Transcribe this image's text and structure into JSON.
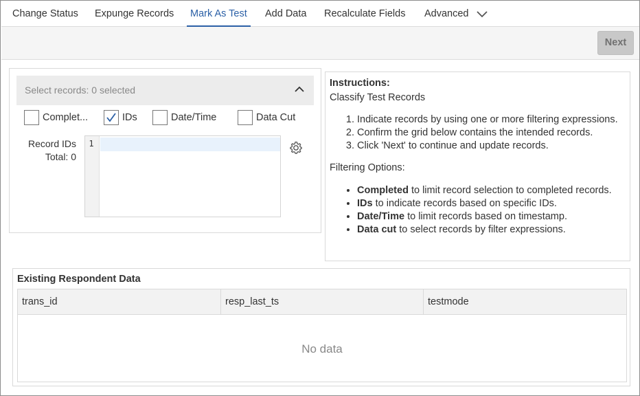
{
  "tabs": [
    {
      "label": "Change Status"
    },
    {
      "label": "Expunge Records"
    },
    {
      "label": "Mark As Test"
    },
    {
      "label": "Add Data"
    },
    {
      "label": "Recalculate Fields"
    },
    {
      "label": "Advanced"
    }
  ],
  "active_tab": "Mark As Test",
  "toolbar": {
    "next_label": "Next"
  },
  "select": {
    "header": "Select records: 0 selected"
  },
  "filters": [
    {
      "label": "Complet...",
      "checked": false
    },
    {
      "label": "IDs",
      "checked": true
    },
    {
      "label": "Date/Time",
      "checked": false
    },
    {
      "label": "Data Cut",
      "checked": false
    }
  ],
  "record_ids": {
    "label": "Record IDs",
    "total": "Total: 0",
    "line_number": "1"
  },
  "instructions": {
    "heading": "Instructions:",
    "subtitle": "Classify Test Records",
    "steps": [
      "Indicate records by using one or more filtering expressions.",
      "Confirm the grid below contains the intended records.",
      "Click 'Next' to continue and update records."
    ],
    "options_heading": "Filtering Options:",
    "options": [
      {
        "term": "Completed",
        "desc": " to limit record selection to completed records."
      },
      {
        "term": "IDs",
        "desc": " to indicate records based on specific IDs."
      },
      {
        "term": "Date/Time",
        "desc": " to limit records based on timestamp."
      },
      {
        "term": "Data cut",
        "desc": " to select records by filter expressions."
      }
    ]
  },
  "existing": {
    "title": "Existing Respondent Data",
    "columns": [
      "trans_id",
      "resp_last_ts",
      "testmode"
    ],
    "empty_text": "No data"
  },
  "colors": {
    "accent": "#2a5fa6",
    "disabled_button": "#c8c8c8"
  },
  "icons": {
    "advanced": "chevron-down-icon",
    "collapse": "chevron-up-icon",
    "settings": "gear-icon",
    "check": "checkmark-icon"
  }
}
